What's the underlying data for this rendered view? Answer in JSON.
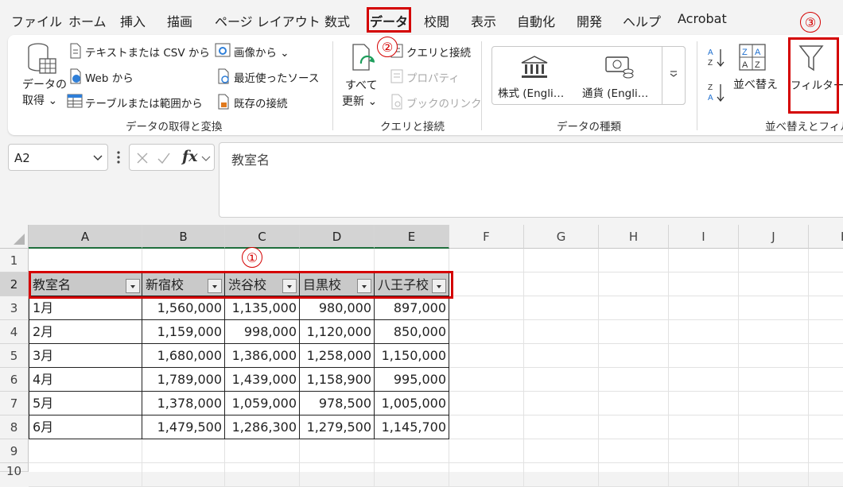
{
  "menu": {
    "tabs": [
      "ファイル",
      "ホーム",
      "挿入",
      "描画",
      "ページ レイアウト",
      "数式",
      "データ",
      "校閲",
      "表示",
      "自動化",
      "開発",
      "ヘルプ",
      "Acrobat"
    ]
  },
  "annotations": {
    "one": "①",
    "two": "②",
    "three": "③"
  },
  "ribbon": {
    "get_data": {
      "label_top": "データの",
      "label_bottom": "取得 ⌄"
    },
    "text_csv": "テキストまたは CSV から",
    "web": "Web から",
    "table_range": "テーブルまたは範囲から",
    "from_image": "画像から ⌄",
    "recent_sources": "最近使ったソース",
    "existing_conn": "既存の接続",
    "group_get_transform": "データの取得と変換",
    "refresh_all": {
      "top": "すべて",
      "bottom": "更新 ⌄"
    },
    "queries_conn": "クエリと接続",
    "properties": "プロパティ",
    "edit_links": "ブックのリンク",
    "group_queries": "クエリと接続",
    "stocks": "株式 (Engli…",
    "currency": "通貨 (Engli…",
    "group_datatypes": "データの種類",
    "sort": "並べ替え",
    "filter": "フィルター",
    "group_sort_filter": "並べ替えとフィルター",
    "sort_az": "A Z",
    "sort_za": "Z A"
  },
  "formula_bar": {
    "name_box": "A2",
    "fx": "fx",
    "formula": "教室名"
  },
  "grid": {
    "columns": [
      "A",
      "B",
      "C",
      "D",
      "E",
      "F",
      "G",
      "H",
      "I",
      "J",
      "K"
    ],
    "rows": [
      "1",
      "2",
      "3",
      "4",
      "5",
      "6",
      "7",
      "8",
      "9",
      "10"
    ],
    "headers": [
      "教室名",
      "新宿校",
      "渋谷校",
      "目黒校",
      "八王子校"
    ],
    "data": [
      [
        "1月",
        "1,560,000",
        "1,135,000",
        "980,000",
        "897,000"
      ],
      [
        "2月",
        "1,159,000",
        "998,000",
        "1,120,000",
        "850,000"
      ],
      [
        "3月",
        "1,680,000",
        "1,386,000",
        "1,258,000",
        "1,150,000"
      ],
      [
        "4月",
        "1,789,000",
        "1,439,000",
        "1,158,900",
        "995,000"
      ],
      [
        "5月",
        "1,378,000",
        "1,059,000",
        "978,500",
        "1,005,000"
      ],
      [
        "6月",
        "1,479,500",
        "1,286,300",
        "1,279,500",
        "1,145,700"
      ]
    ]
  },
  "colors": {
    "annotation": "#d40000",
    "selected_header": "#d3d3d3",
    "table_header_bg": "#c9c9c9"
  }
}
